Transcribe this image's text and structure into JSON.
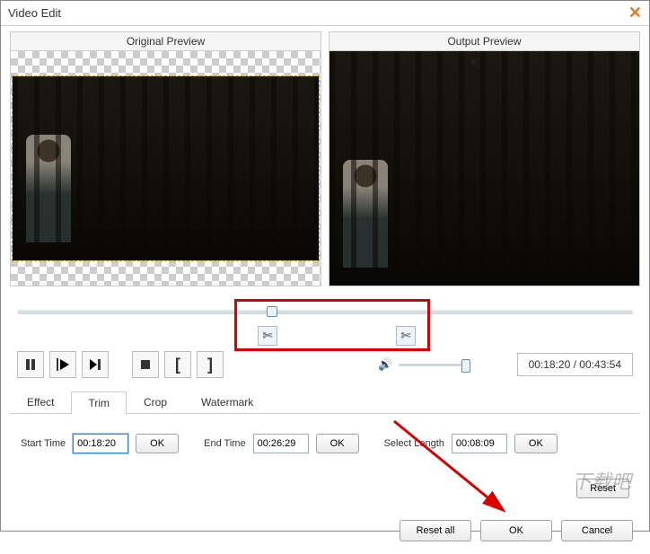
{
  "title": "Video Edit",
  "previews": {
    "original": "Original Preview",
    "output": "Output Preview"
  },
  "timeline": {
    "scissor_glyph": "✄"
  },
  "controls": {
    "volume_glyph": "🔊",
    "time_display": "00:18:20 / 00:43:54"
  },
  "tabs": {
    "effect": "Effect",
    "trim": "Trim",
    "crop": "Crop",
    "watermark": "Watermark"
  },
  "trim": {
    "start_label": "Start Time",
    "start_value": "00:18:20",
    "ok": "OK",
    "end_label": "End Time",
    "end_value": "00:26:29",
    "select_label": "Select Length",
    "select_value": "00:08:09",
    "reset": "Reset"
  },
  "footer": {
    "reset_all": "Reset all",
    "ok": "OK",
    "cancel": "Cancel"
  }
}
